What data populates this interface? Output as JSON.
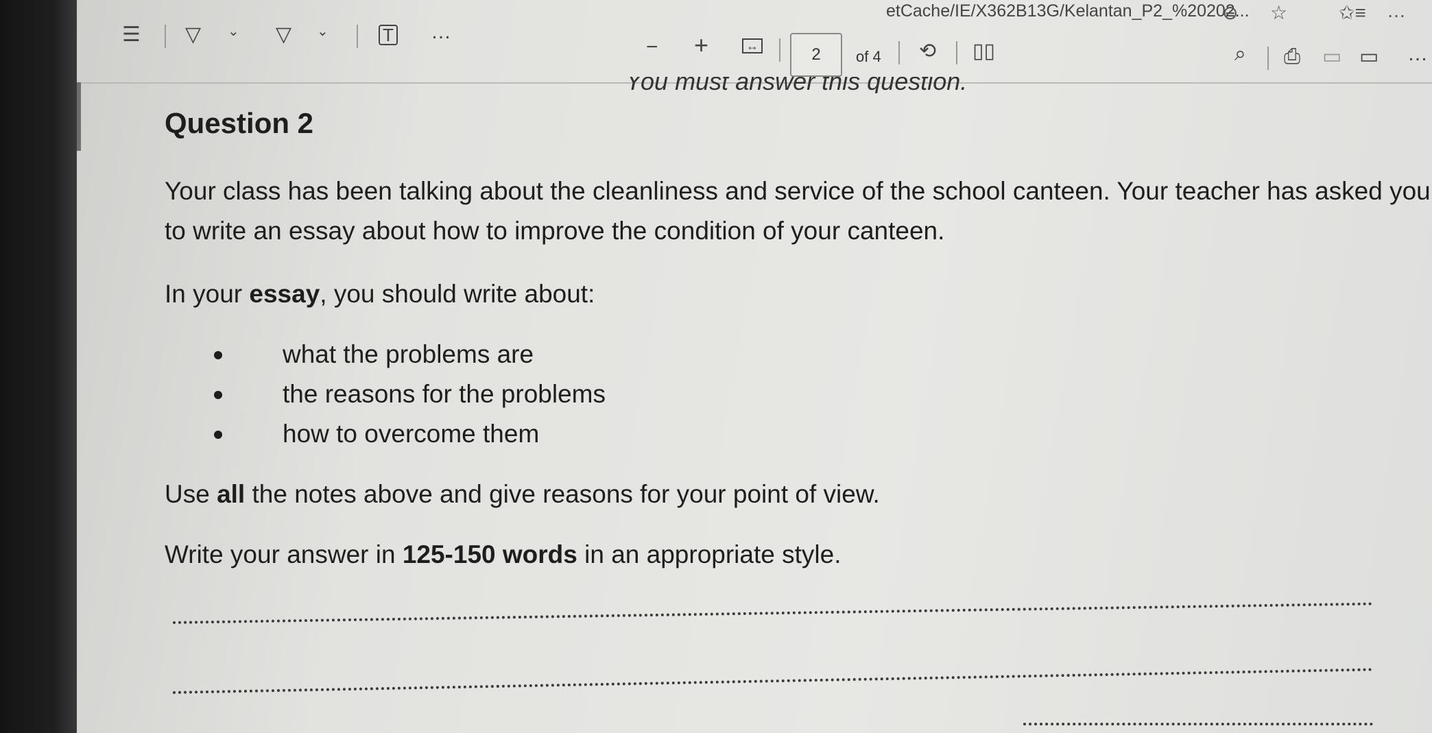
{
  "browser": {
    "url_fragment": "etCache/IE/X362B13G/Kelantan_P2_%20202...",
    "icons": [
      "zoom-out-icon",
      "star-icon",
      "favorites-icon",
      "more-icon"
    ]
  },
  "toolbar": {
    "icons_left": [
      "list-icon",
      "highlight-icon",
      "chevron-down-icon",
      "draw-icon",
      "chevron-down-icon",
      "text-icon",
      "more-icon"
    ],
    "zoom_out": "−",
    "zoom_in": "+",
    "current_page": "2",
    "page_total": "of 4",
    "icons_right": [
      "rotate-icon",
      "page-view-icon",
      "search-icon",
      "print-icon",
      "save-icon",
      "save-as-icon"
    ]
  },
  "document": {
    "cut_off_line": "You must answer this question.",
    "question_title": "Question 2",
    "intro": "Your class has been talking about the cleanliness and service of the school canteen. Your teacher has asked you to write an essay about how to improve the condition of your canteen.",
    "prompt_pre": "In your ",
    "prompt_bold": "essay",
    "prompt_post": ", you should write about:",
    "bullets": [
      "what the problems are",
      "the reasons for the problems",
      "how to overcome them"
    ],
    "notes_pre": "Use ",
    "notes_bold": "all",
    "notes_post": " the notes above and give reasons for your point of view.",
    "words_pre": "Write your answer in ",
    "words_bold": "125-150 words",
    "words_post": " in an appropriate style."
  }
}
